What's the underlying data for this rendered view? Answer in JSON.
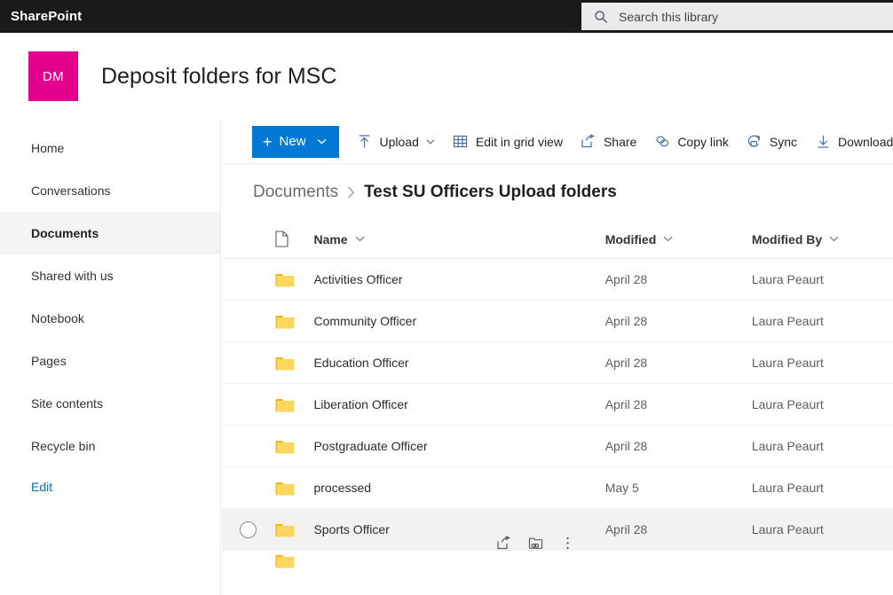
{
  "suite": {
    "brand": "SharePoint",
    "search_placeholder": "Search this library",
    "search_value": "",
    "search_icon": "search-icon",
    "bar_color": "#1b1a19"
  },
  "site": {
    "logo_initials": "DM",
    "logo_color": "#e3008c",
    "title": "Deposit folders for MSC"
  },
  "sidebar": {
    "items": [
      {
        "label": "Home",
        "selected": false
      },
      {
        "label": "Conversations",
        "selected": false
      },
      {
        "label": "Documents",
        "selected": true
      },
      {
        "label": "Shared with us",
        "selected": false
      },
      {
        "label": "Notebook",
        "selected": false
      },
      {
        "label": "Pages",
        "selected": false
      },
      {
        "label": "Site contents",
        "selected": false
      },
      {
        "label": "Recycle bin",
        "selected": false
      }
    ],
    "edit_label": "Edit",
    "edit_color": "#0b6fb5"
  },
  "command_bar": {
    "new_label": "New",
    "new_color": "#0078d4",
    "commands": [
      {
        "label": "Upload",
        "icon": "upload-icon",
        "has_chevron": true
      },
      {
        "label": "Edit in grid view",
        "icon": "grid-icon",
        "has_chevron": false
      },
      {
        "label": "Share",
        "icon": "share-icon",
        "has_chevron": false
      },
      {
        "label": "Copy link",
        "icon": "link-icon",
        "has_chevron": false
      },
      {
        "label": "Sync",
        "icon": "sync-icon",
        "has_chevron": false
      },
      {
        "label": "Download",
        "icon": "download-icon",
        "has_chevron": false
      }
    ]
  },
  "breadcrumb": {
    "root": "Documents",
    "separator": "›",
    "current": "Test SU Officers Upload folders"
  },
  "list": {
    "columns": {
      "type_icon": "file-type-icon",
      "name": "Name",
      "modified": "Modified",
      "modified_by": "Modified By"
    },
    "rows": [
      {
        "name": "Activities Officer",
        "modified": "April 28",
        "modified_by": "Laura Peaurt",
        "icon": "folder-icon",
        "hovered": false
      },
      {
        "name": "Community Officer",
        "modified": "April 28",
        "modified_by": "Laura Peaurt",
        "icon": "folder-icon",
        "hovered": false
      },
      {
        "name": "Education Officer",
        "modified": "April 28",
        "modified_by": "Laura Peaurt",
        "icon": "folder-icon",
        "hovered": false
      },
      {
        "name": "Liberation Officer",
        "modified": "April 28",
        "modified_by": "Laura Peaurt",
        "icon": "folder-icon",
        "hovered": false
      },
      {
        "name": "Postgraduate Officer",
        "modified": "April 28",
        "modified_by": "Laura Peaurt",
        "icon": "folder-icon",
        "hovered": false
      },
      {
        "name": "processed",
        "modified": "May 5",
        "modified_by": "Laura Peaurt",
        "icon": "folder-icon",
        "hovered": false
      },
      {
        "name": "Sports Officer",
        "modified": "April 28",
        "modified_by": "Laura Peaurt",
        "icon": "folder-icon",
        "hovered": true
      }
    ],
    "row_actions": [
      {
        "name": "share-icon"
      },
      {
        "name": "copy-link-icon"
      },
      {
        "name": "more-options-icon"
      }
    ],
    "folder_color": "#ffd75e"
  }
}
